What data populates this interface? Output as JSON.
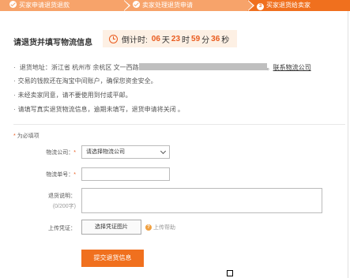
{
  "steps": [
    {
      "label": "买家申请退货退款",
      "state": "done"
    },
    {
      "label": "卖家处理退货申请",
      "state": "done"
    },
    {
      "number": "3",
      "label": "买家退货给卖家",
      "state": "current"
    }
  ],
  "title": "请退货并填写物流信息",
  "countdown": {
    "label": "倒计时:",
    "days": "06",
    "days_unit": "天",
    "hours": "23",
    "hours_unit": "时",
    "minutes": "59",
    "minutes_unit": "分",
    "seconds": "36",
    "seconds_unit": "秒"
  },
  "info": {
    "address_prefix": "退货地址：浙江省 杭州市 余杭区 文一西路",
    "address_link": "联系物流公司",
    "line2": "交易的钱款还在淘宝中间账户，确保您资金安全。",
    "line3": "未经卖家同意，请不要使用到付或平邮。",
    "line4": "请填写真实退货物流信息，逾期未填写，退货申请将关闭 。"
  },
  "form": {
    "required_note": "为必填项",
    "logistics_label": "物流公司：",
    "logistics_value": "请选择物流公司",
    "tracking_label": "物流单号：",
    "tracking_value": "",
    "desc_label": "退货说明：",
    "desc_counter": "(0/200字)",
    "desc_value": "",
    "upload_label": "上传凭证：",
    "upload_button": "选择凭证图片",
    "upload_help": "上传帮助",
    "submit": "提交退货信息"
  },
  "colors": {
    "accent": "#f0701e",
    "step_done": "#f7a36a",
    "countdown_bg": "#fdf0e4"
  }
}
